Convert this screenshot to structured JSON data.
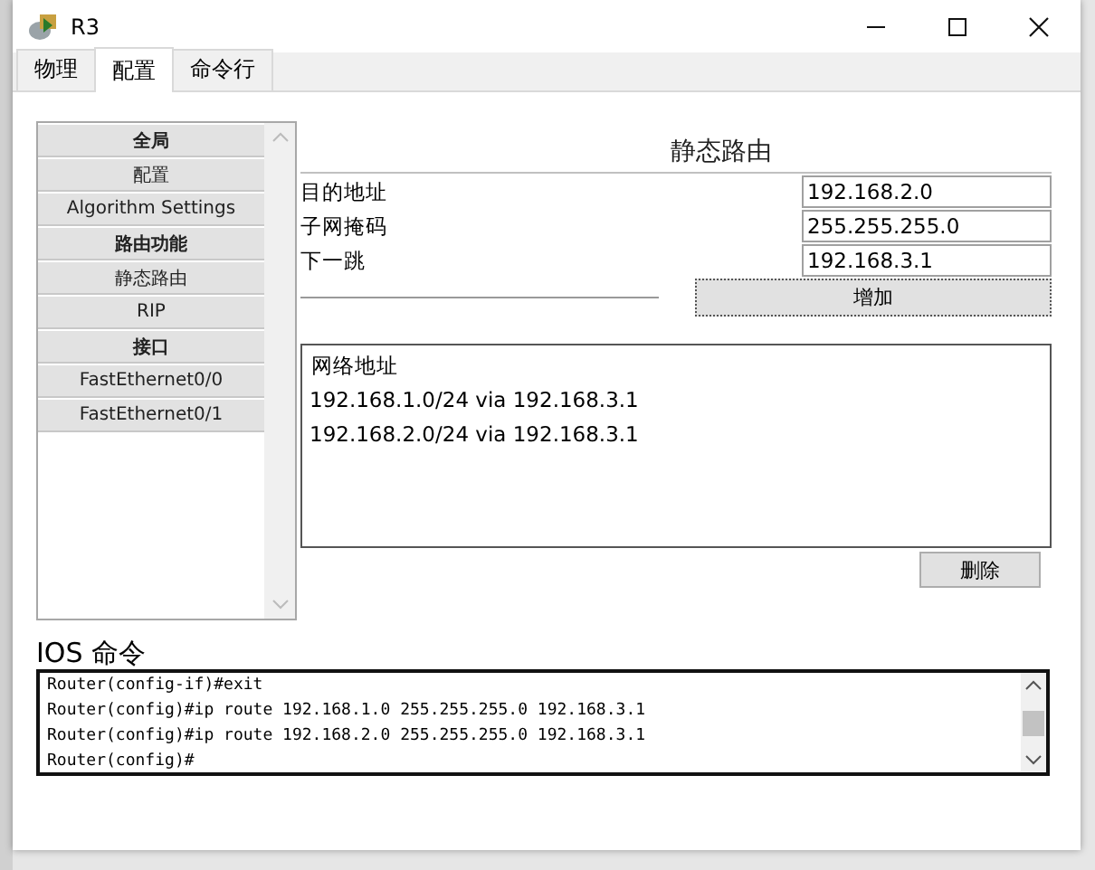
{
  "window": {
    "title": "R3"
  },
  "tabs": [
    {
      "label": "物理",
      "selected": false
    },
    {
      "label": "配置",
      "selected": true
    },
    {
      "label": "命令行",
      "selected": false
    }
  ],
  "sidebar": {
    "items": [
      {
        "label": "全局",
        "kind": "header"
      },
      {
        "label": "配置",
        "kind": "item"
      },
      {
        "label": "Algorithm Settings",
        "kind": "item"
      },
      {
        "label": "路由功能",
        "kind": "header"
      },
      {
        "label": "静态路由",
        "kind": "item"
      },
      {
        "label": "RIP",
        "kind": "item"
      },
      {
        "label": "接口",
        "kind": "header"
      },
      {
        "label": "FastEthernet0/0",
        "kind": "item"
      },
      {
        "label": "FastEthernet0/1",
        "kind": "item"
      }
    ]
  },
  "static_route": {
    "title": "静态路由",
    "fields": [
      {
        "label": "目的地址",
        "value": "192.168.2.0"
      },
      {
        "label": "子网掩码",
        "value": "255.255.255.0"
      },
      {
        "label": "下一跳",
        "value": "192.168.3.1"
      }
    ],
    "add_button": "增加",
    "list_header": "网络地址",
    "routes": [
      "192.168.1.0/24 via 192.168.3.1",
      "192.168.2.0/24 via 192.168.3.1"
    ],
    "delete_button": "删除"
  },
  "ios": {
    "title": "IOS 命令",
    "lines": [
      "Router(config-if)#exit",
      "Router(config)#ip route 192.168.1.0 255.255.255.0 192.168.3.1",
      "Router(config)#ip route 192.168.2.0 255.255.255.0 192.168.3.1",
      "Router(config)#"
    ]
  }
}
